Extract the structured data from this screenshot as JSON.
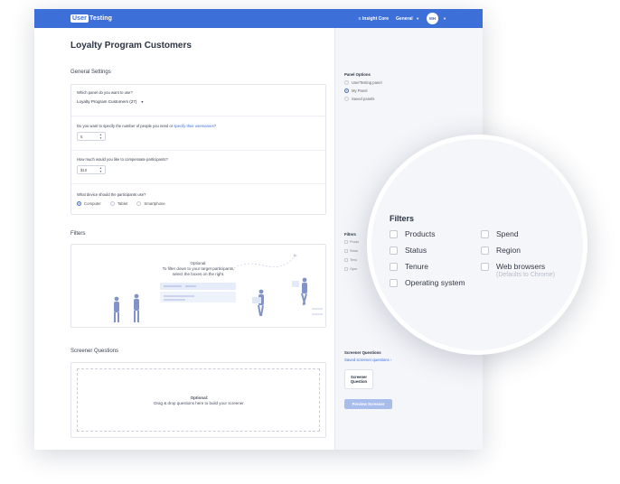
{
  "header": {
    "logo_user": "User",
    "logo_testing": "Testing",
    "nav_insight": "≡ Insight Core",
    "nav_general": "General",
    "avatar_initials": "MH"
  },
  "main": {
    "page_title": "Loyalty Program Customers",
    "general_settings_heading": "General Settings",
    "q_panel": "Which panel do you want to use?",
    "panel_selected": "Loyalty Program Customers (27)",
    "q_number_prefix": "Do you want to specify the number of people you need or ",
    "q_number_link": "specify their usernames",
    "q_number_suffix": "?",
    "number_value": "5",
    "q_compensate": "How much would you like to compensate participants?",
    "compensate_value": "$10",
    "q_device": "What device should the participants use?",
    "devices": [
      "Computer",
      "Tablet",
      "Smartphone"
    ],
    "filters_heading": "Filters",
    "filters_optional": "Optional:",
    "filters_hint_1": "To filter down to your target participants,",
    "filters_hint_2": "select the boxes on the right.",
    "screener_heading": "Screener Questions",
    "screener_optional": "Optional:",
    "screener_hint": "Drag & drop questions here to build your screener."
  },
  "side": {
    "panel_options_heading": "Panel Options",
    "panel_options": [
      "UserTesting panel",
      "My Panel",
      "Saved panels"
    ],
    "filters_heading": "Filters",
    "filter_minis": [
      "Produ",
      "Statu",
      "Tenu",
      "Oper"
    ],
    "screener_heading": "Screener Questions",
    "saved_screener_link": "Saved screener questions ›",
    "screener_button_l1": "Screener",
    "screener_button_l2": "Question",
    "preview_button": "Preview Screener"
  },
  "lens": {
    "title": "Filters",
    "col1": [
      "Products",
      "Status",
      "Tenure",
      "Operating system"
    ],
    "col2": [
      "Spend",
      "Region",
      "Web browsers"
    ],
    "web_browsers_note": "(Defaults to Chrome)"
  },
  "colors": {
    "brand": "#3d6fd8",
    "preview_button": "#a9bdec"
  }
}
